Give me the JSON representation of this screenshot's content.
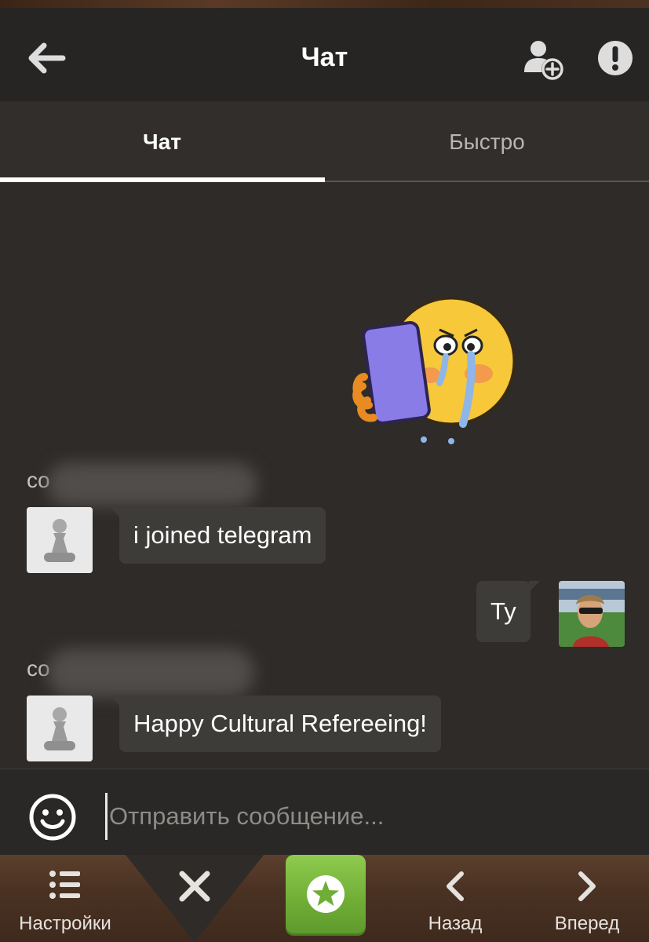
{
  "header": {
    "title": "Чат"
  },
  "tabs": [
    {
      "label": "Чат",
      "active": true
    },
    {
      "label": "Быстро",
      "active": false
    }
  ],
  "messages": [
    {
      "sender_visible": "co",
      "text": "i joined telegram",
      "side": "left"
    },
    {
      "sender_visible": "",
      "text": "Ty",
      "side": "right"
    },
    {
      "sender_visible": "co",
      "text": "Happy Cultural Refereeing!",
      "side": "left"
    }
  ],
  "input": {
    "placeholder": "Отправить сообщение..."
  },
  "bottom_nav": {
    "settings_label": "Настройки",
    "back_label": "Назад",
    "forward_label": "Вперед"
  },
  "icons": {
    "back": "arrow-left-icon",
    "add_friend": "add-friend-icon",
    "report": "exclamation-icon",
    "emoji": "smiley-icon",
    "settings": "list-icon",
    "close": "close-icon",
    "star": "star-icon",
    "nav_back": "chevron-left-icon",
    "nav_forward": "chevron-right-icon"
  },
  "colors": {
    "accent_green": "#6fad36",
    "header_bg": "#272523",
    "bubble_bg": "#3e3c39"
  }
}
